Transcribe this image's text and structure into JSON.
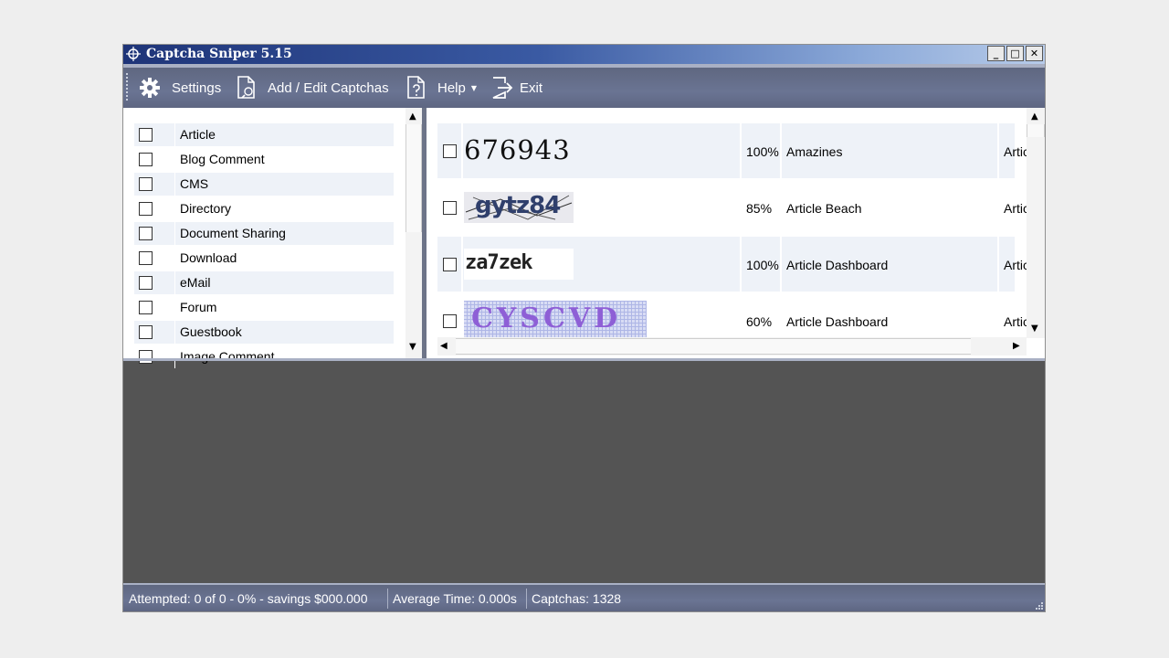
{
  "window": {
    "title": "Captcha Sniper 5.15"
  },
  "toolbar": {
    "settings_label": "Settings",
    "add_edit_label": "Add / Edit Captchas",
    "help_label": "Help",
    "exit_label": "Exit"
  },
  "categories": [
    {
      "label": "Article"
    },
    {
      "label": "Blog Comment"
    },
    {
      "label": "CMS"
    },
    {
      "label": "Directory"
    },
    {
      "label": "Document Sharing"
    },
    {
      "label": "Download"
    },
    {
      "label": "eMail"
    },
    {
      "label": "Forum"
    },
    {
      "label": "Guestbook"
    },
    {
      "label": "Image Comment"
    }
  ],
  "captchas": [
    {
      "text": "676943",
      "percent": "100%",
      "name": "Amazines",
      "category": "Article"
    },
    {
      "text": "gytz84",
      "percent": "85%",
      "name": "Article Beach",
      "category": "Article"
    },
    {
      "text": "za7zek",
      "percent": "100%",
      "name": "Article Dashboard",
      "category": "Article"
    },
    {
      "text": "CYSCVD",
      "percent": "60%",
      "name": "Article Dashboard",
      "category": "Article"
    }
  ],
  "status": {
    "attempted": "Attempted: 0 of 0 - 0% - savings $000.000",
    "average_time": "Average Time: 0.000s",
    "captchas": "Captchas: 1328"
  },
  "colors": {
    "title_gradient_start": "#1e3478",
    "toolbar": "#656e8b",
    "workspace": "#545454",
    "row_alt": "#eef2f8"
  }
}
